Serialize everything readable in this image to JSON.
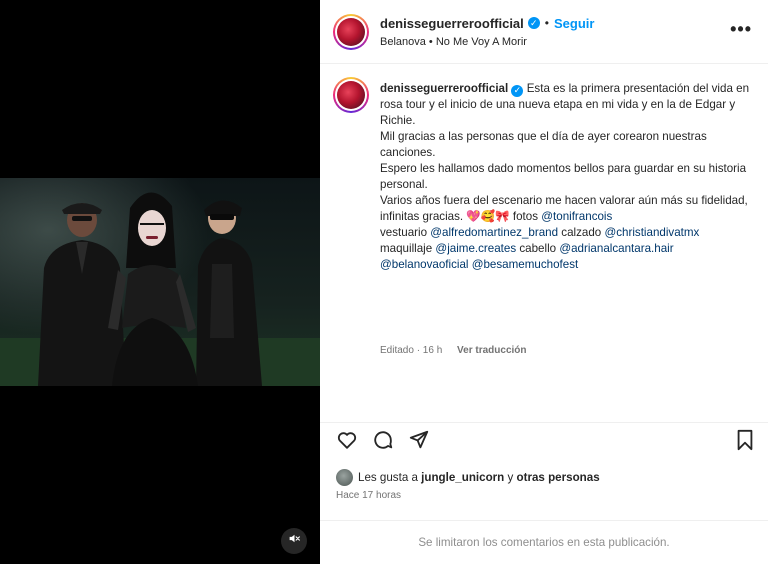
{
  "post": {
    "username": "denisseguerreroofficial",
    "follow_label": "Seguir",
    "separator": "•",
    "audio": "Belanova • No Me Voy A Morir",
    "more_label": "•••"
  },
  "caption": {
    "username": "denisseguerreroofficial",
    "p1": "Esta es la primera presentación del vida en rosa tour y el inicio de una nueva etapa en mi vida y en la de Edgar y Richie.",
    "p2": "Mil gracias a las personas que el día de ayer corearon nuestras canciones.",
    "p3": "Espero les hallamos dado momentos bellos para guardar en su historia personal.",
    "p4a": "Varios años fuera del escenario me hacen valorar aún más su fidelidad, infinitas gracias. ",
    "emojis": "💖🥰🎀",
    "p4b": " fotos ",
    "m1": "@tonifrancois",
    "t1": "vestuario ",
    "m2": "@alfredomartinez_brand",
    "t2": " calzado ",
    "m3": "@christiandivatmx",
    "t3": "maquillaje ",
    "m4": "@jaime.creates",
    "t4": " cabello ",
    "m5": "@adrianalcantara.hair",
    "m6": "@belanovaoficial",
    "m7": "@besamemuchofest",
    "edited": "Editado · 16 h",
    "translate": "Ver traducción"
  },
  "engagement": {
    "likes_prefix": "Les gusta a ",
    "likes_user": "jungle_unicorn",
    "likes_mid": " y ",
    "likes_others": "otras personas",
    "time": "Hace 17 horas",
    "comments_off": "Se limitaron los comentarios en esta publicación."
  },
  "icons": {
    "verified": "verified-badge-icon",
    "like": "heart-icon",
    "comment": "comment-icon",
    "share": "send-icon",
    "save": "bookmark-icon",
    "mute": "speaker-muted-icon"
  },
  "colors": {
    "accent": "#0095f6",
    "mention": "#00376b",
    "muted_text": "#737373",
    "media_bg": "#000000"
  }
}
